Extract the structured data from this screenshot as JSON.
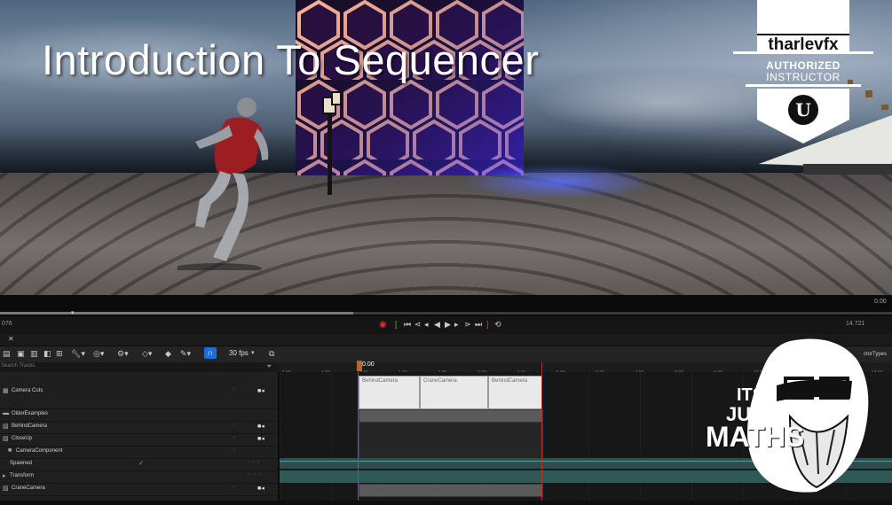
{
  "thumbnail": {
    "title": "Introduction To Sequencer",
    "badge": {
      "name": "tharlevfx",
      "line1": "AUTHORIZED",
      "line2": "INSTRUCTOR"
    },
    "logo_text": {
      "line1": "ITS",
      "line2": "JUST",
      "line3": "MATHS"
    }
  },
  "scrubber": {
    "time_label": "0.00"
  },
  "transport": {
    "left_value": "076",
    "right_value": "14.721"
  },
  "toolbar": {
    "fps": "30 fps",
    "actor_types": "ctorTypes"
  },
  "search": {
    "placeholder": "Search Tracks"
  },
  "timeline": {
    "playhead_time": "0.00",
    "ruler_ticks": [
      "-2.00",
      "-1.00",
      "0.00",
      "1.00",
      "2.00",
      "3.00",
      "4.00",
      "5.00",
      "6.00",
      "7.00",
      "8.00",
      "9.00",
      "10.00",
      "11.00",
      "12.00",
      "13.00"
    ]
  },
  "tracks": [
    {
      "label": "Camera Cuts",
      "icon": "camera-cuts-icon"
    },
    {
      "label": "OlderExamples",
      "icon": "folder-icon"
    },
    {
      "label": "BehindCamera",
      "icon": "camera-actor-icon"
    },
    {
      "label": "CloseUp",
      "icon": "camera-actor-icon"
    },
    {
      "label": "CameraComponent",
      "icon": "camera-component-icon"
    },
    {
      "label": "Spawned",
      "icon": "checkbox-icon"
    },
    {
      "label": "Transform",
      "icon": "expand-arrow-icon"
    },
    {
      "label": "CraneCamera",
      "icon": "camera-actor-icon"
    }
  ],
  "camera_cuts": [
    "BehindCamera",
    "CraneCamera",
    "BehindCamera"
  ],
  "colors": {
    "accent": "#1d6fd8",
    "playhead": "#c0632b",
    "end_marker": "#b13030",
    "teal_track": "#2d5a57"
  }
}
